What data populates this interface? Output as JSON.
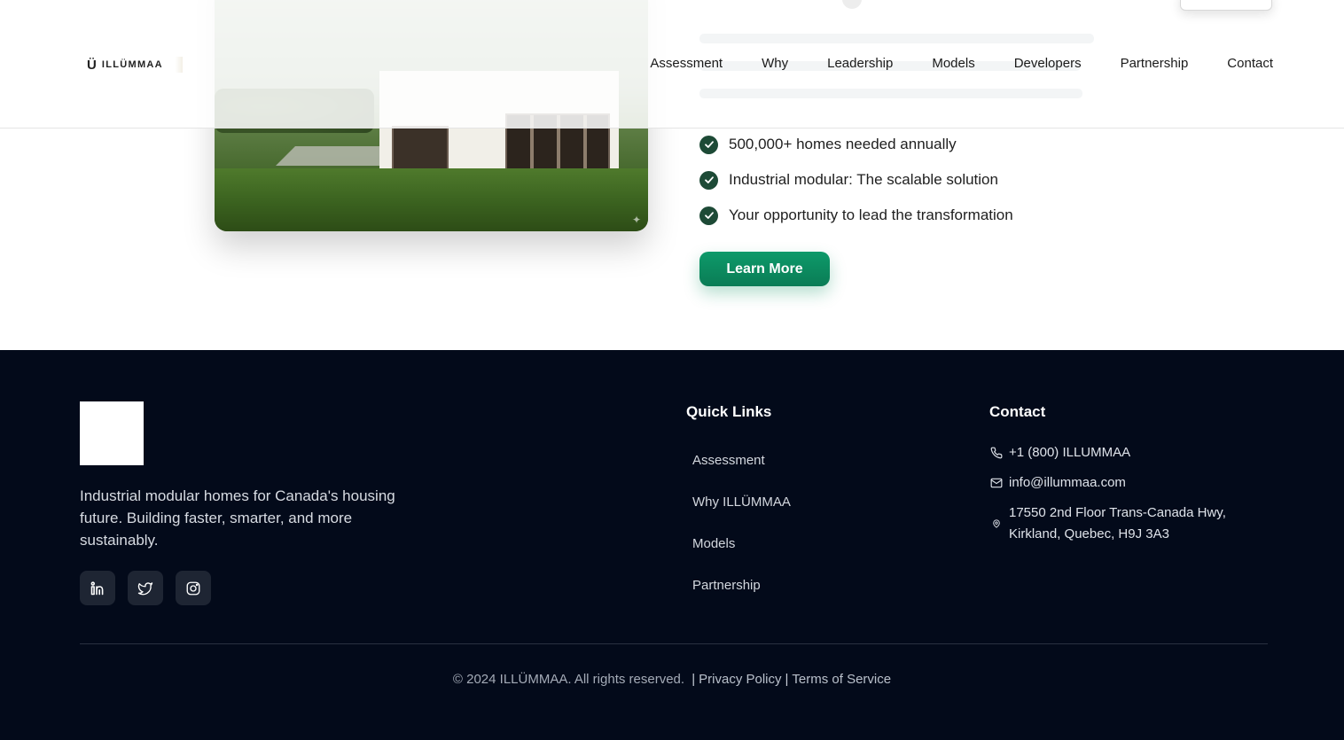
{
  "brand": {
    "name": "ILLÜMMAA",
    "mark": "Ü"
  },
  "nav": [
    "Assessment",
    "Why",
    "Leadership",
    "Models",
    "Developers",
    "Partnership",
    "Contact"
  ],
  "hero": {
    "bullets": [
      "500,000+ homes needed annually",
      "Industrial modular: The scalable solution",
      "Your opportunity to lead the transformation"
    ],
    "cta_label": "Learn More"
  },
  "footer": {
    "tagline": "Industrial modular homes for Canada's housing future. Building faster, smarter, and more sustainably.",
    "socials": [
      "linkedin-icon",
      "twitter-icon",
      "instagram-icon"
    ],
    "quick_links_title": "Quick Links",
    "quick_links": [
      "Assessment",
      "Why ILLÜMMAA",
      "Models",
      "Partnership"
    ],
    "contact_title": "Contact",
    "phone": "+1 (800) ILLUMMAA",
    "email": "info@illummaa.com",
    "address_line1": "17550 2nd Floor Trans-Canada Hwy,",
    "address_line2": "Kirkland, Quebec, H9J 3A3",
    "copyright": "© 2024 ILLÜMMAA. All rights reserved.",
    "privacy": "Privacy Policy",
    "terms": "Terms of Service",
    "separator": "|"
  },
  "colors": {
    "accent": "#0e9a6a",
    "check": "#1d4a36",
    "footer_bg": "#030a1a"
  }
}
